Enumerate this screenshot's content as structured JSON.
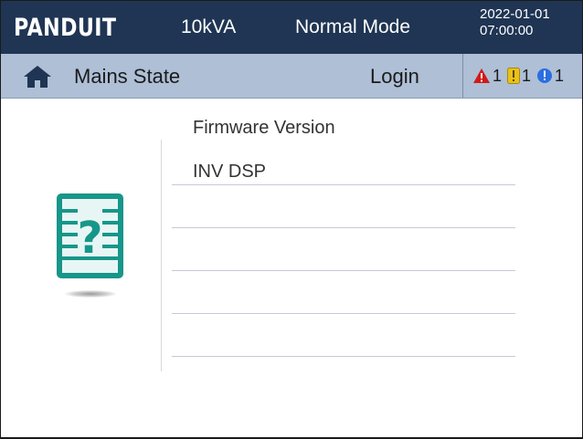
{
  "header": {
    "brand": "PANDUIT",
    "rating": "10kVA",
    "mode": "Normal Mode",
    "date": "2022-01-01",
    "time": "07:00:00"
  },
  "statusbar": {
    "home_icon": "house-icon",
    "title": "Mains State",
    "login_label": "Login",
    "alarms": [
      {
        "icon": "warning-triangle-icon",
        "color": "#d01a1a",
        "count": "1"
      },
      {
        "icon": "exclamation-square-icon",
        "color": "#e8c11a",
        "count": "1"
      },
      {
        "icon": "info-circle-icon",
        "color": "#2a6fe0",
        "count": "1"
      }
    ]
  },
  "main": {
    "icon": "help-document-icon",
    "heading": "Firmware Version",
    "rows": [
      "INV DSP",
      "",
      "",
      "",
      ""
    ]
  },
  "colors": {
    "header_bg": "#1f3553",
    "statusbar_bg": "#aebfd6",
    "icon_teal": "#17968a"
  }
}
